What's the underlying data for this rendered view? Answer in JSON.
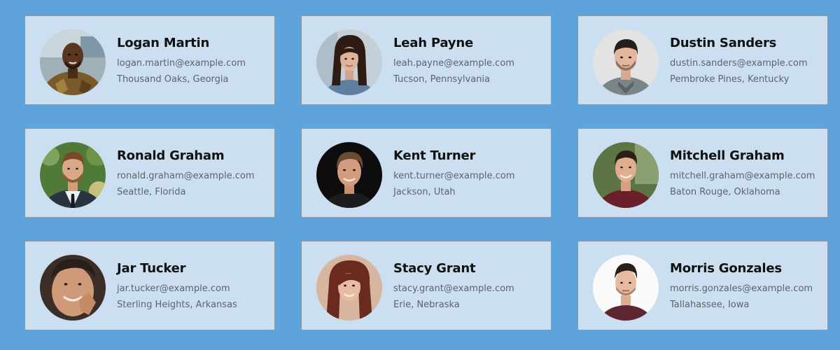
{
  "contacts": [
    {
      "name": "Logan Martin",
      "email": "logan.martin@example.com",
      "location": "Thousand Oaks, Georgia"
    },
    {
      "name": "Leah Payne",
      "email": "leah.payne@example.com",
      "location": "Tucson, Pennsylvania"
    },
    {
      "name": "Dustin Sanders",
      "email": "dustin.sanders@example.com",
      "location": "Pembroke Pines, Kentucky"
    },
    {
      "name": "Ronald Graham",
      "email": "ronald.graham@example.com",
      "location": "Seattle, Florida"
    },
    {
      "name": "Kent Turner",
      "email": "kent.turner@example.com",
      "location": "Jackson, Utah"
    },
    {
      "name": "Mitchell Graham",
      "email": "mitchell.graham@example.com",
      "location": "Baton Rouge, Oklahoma"
    },
    {
      "name": "Jar Tucker",
      "email": "jar.tucker@example.com",
      "location": "Sterling Heights, Arkansas"
    },
    {
      "name": "Stacy Grant",
      "email": "stacy.grant@example.com",
      "location": "Erie, Nebraska"
    },
    {
      "name": "Morris Gonzales",
      "email": "morris.gonzales@example.com",
      "location": "Tallahassee, Iowa"
    }
  ],
  "colors": {
    "page_background": "#5fa3dc",
    "card_background": "#cbdff0",
    "card_border": "#8f9aa4",
    "name_text": "#111111",
    "detail_text": "#5a646d"
  }
}
